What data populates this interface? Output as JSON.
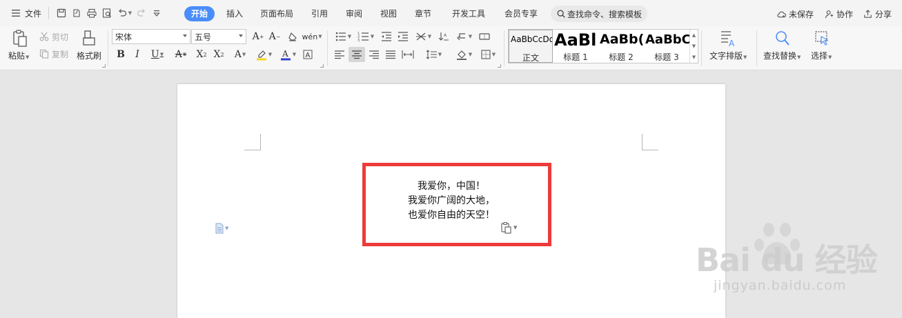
{
  "menu": {
    "file_label": "文件",
    "tabs": [
      {
        "label": "开始",
        "active": true
      },
      {
        "label": "插入",
        "active": false
      },
      {
        "label": "页面布局",
        "active": false
      },
      {
        "label": "引用",
        "active": false
      },
      {
        "label": "审阅",
        "active": false
      },
      {
        "label": "视图",
        "active": false
      },
      {
        "label": "章节",
        "active": false
      },
      {
        "label": "开发工具",
        "active": false
      },
      {
        "label": "会员专享",
        "active": false
      }
    ],
    "search_text": "查找命令、搜索模板",
    "right_actions": {
      "unsaved": "未保存",
      "collaborate": "协作",
      "share": "分享"
    }
  },
  "ribbon": {
    "paste": "粘贴",
    "cut": "剪切",
    "copy": "复制",
    "format_painter": "格式刷",
    "font_name": "宋体",
    "font_size": "五号",
    "styles": [
      {
        "preview": "AaBbCcDd",
        "name": "正文"
      },
      {
        "preview": "AaBl",
        "name": "标题 1"
      },
      {
        "preview": "AaBb(",
        "name": "标题 2"
      },
      {
        "preview": "AaBbC",
        "name": "标题 3"
      }
    ],
    "text_layout": "文字排版",
    "find_replace": "查找替换",
    "select": "选择"
  },
  "document": {
    "lines": [
      "我爱你，中国！",
      "我爱你广阔的大地，",
      "也爱你自由的天空！"
    ]
  },
  "watermark": {
    "main": "Bai du 经验",
    "sub": "jingyan.baidu.com"
  },
  "colors": {
    "accent": "#4a8df8",
    "highlight_border": "#ee3a3a",
    "font_color_bar": "#2f3fd1",
    "highlight_color_bar": "#f5d71c"
  }
}
